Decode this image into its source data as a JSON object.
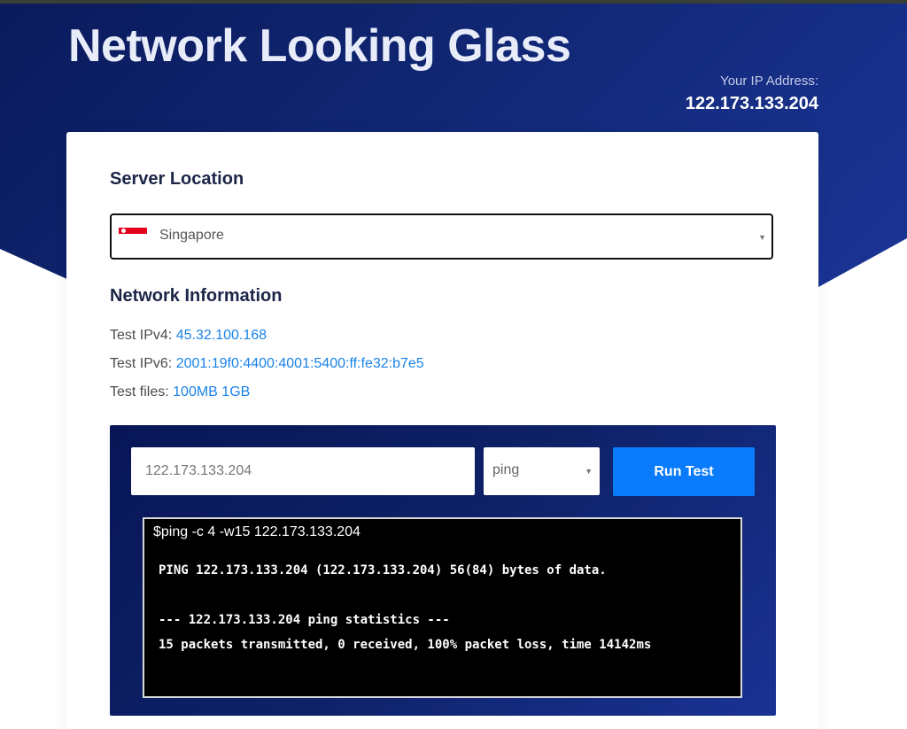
{
  "header": {
    "title": "Network Looking Glass",
    "ip_label": "Your IP Address:",
    "ip_value": "122.173.133.204"
  },
  "server_location": {
    "heading": "Server Location",
    "selected": "Singapore",
    "flag_icon": "singapore-flag-icon"
  },
  "network_info": {
    "heading": "Network Information",
    "ipv4_label": "Test IPv4:",
    "ipv4_value": "45.32.100.168",
    "ipv6_label": "Test IPv6:",
    "ipv6_value": "2001:19f0:4400:4001:5400:ff:fe32:b7e5",
    "files_label": "Test files:",
    "files": [
      "100MB",
      "1GB"
    ]
  },
  "test": {
    "host_value": "122.173.133.204",
    "method_selected": "ping",
    "run_label": "Run Test"
  },
  "terminal": {
    "command": "$ping -c 4 -w15 122.173.133.204",
    "lines": [
      "PING 122.173.133.204 (122.173.133.204) 56(84) bytes of data.",
      "--- 122.173.133.204 ping statistics ---",
      "15 packets transmitted, 0 received, 100% packet loss, time 14142ms"
    ]
  },
  "colors": {
    "hero_dark": "#0a1a5c",
    "hero_light": "#1b3597",
    "link": "#1a83e8",
    "button": "#0a7cfb"
  }
}
